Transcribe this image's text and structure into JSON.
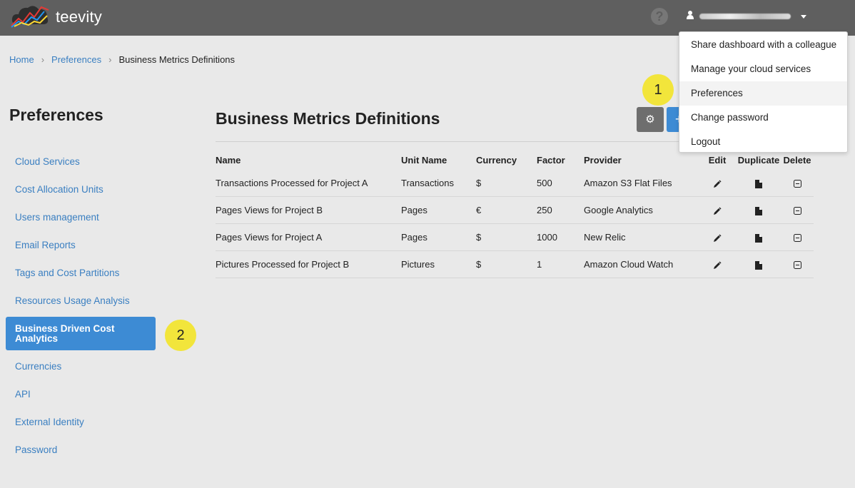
{
  "app": {
    "logo_text": "teevity"
  },
  "header": {
    "help_icon": "question-circle-icon",
    "user_icon": "user-icon"
  },
  "breadcrumb": {
    "items": [
      "Home",
      "Preferences"
    ],
    "current": "Business Metrics Definitions"
  },
  "sidebar": {
    "title": "Preferences",
    "items": [
      {
        "label": "Cloud Services"
      },
      {
        "label": "Cost Allocation Units"
      },
      {
        "label": "Users management"
      },
      {
        "label": "Email Reports"
      },
      {
        "label": "Tags and Cost Partitions"
      },
      {
        "label": "Resources Usage Analysis"
      },
      {
        "label": "Business Driven Cost Analytics",
        "active": true
      },
      {
        "label": "Currencies"
      },
      {
        "label": "API"
      },
      {
        "label": "External Identity"
      },
      {
        "label": "Password"
      }
    ]
  },
  "main": {
    "title": "Business Metrics Definitions",
    "columns": [
      "Name",
      "Unit Name",
      "Currency",
      "Factor",
      "Provider",
      "Edit",
      "Duplicate",
      "Delete"
    ],
    "rows": [
      {
        "name": "Transactions Processed for Project A",
        "unit": "Transactions",
        "currency": "$",
        "factor": "500",
        "provider": "Amazon S3 Flat Files"
      },
      {
        "name": "Pages Views for Project B",
        "unit": "Pages",
        "currency": "€",
        "factor": "250",
        "provider": "Google Analytics"
      },
      {
        "name": "Pages Views for Project A",
        "unit": "Pages",
        "currency": "$",
        "factor": "1000",
        "provider": "New Relic"
      },
      {
        "name": "Pictures Processed for Project B",
        "unit": "Pictures",
        "currency": "$",
        "factor": "1",
        "provider": "Amazon Cloud Watch"
      }
    ]
  },
  "dropdown": {
    "items": [
      {
        "label": "Share dashboard with a colleague"
      },
      {
        "label": "Manage your cloud services"
      },
      {
        "label": "Preferences",
        "highlight": true
      },
      {
        "label": "Change password"
      },
      {
        "label": "Logout"
      }
    ]
  },
  "badges": {
    "one": "1",
    "two": "2"
  },
  "colors": {
    "topbar": "#5f5f5f",
    "accent": "#3d8bd4",
    "link": "#3a7fc1",
    "badge": "#f2e53b"
  }
}
